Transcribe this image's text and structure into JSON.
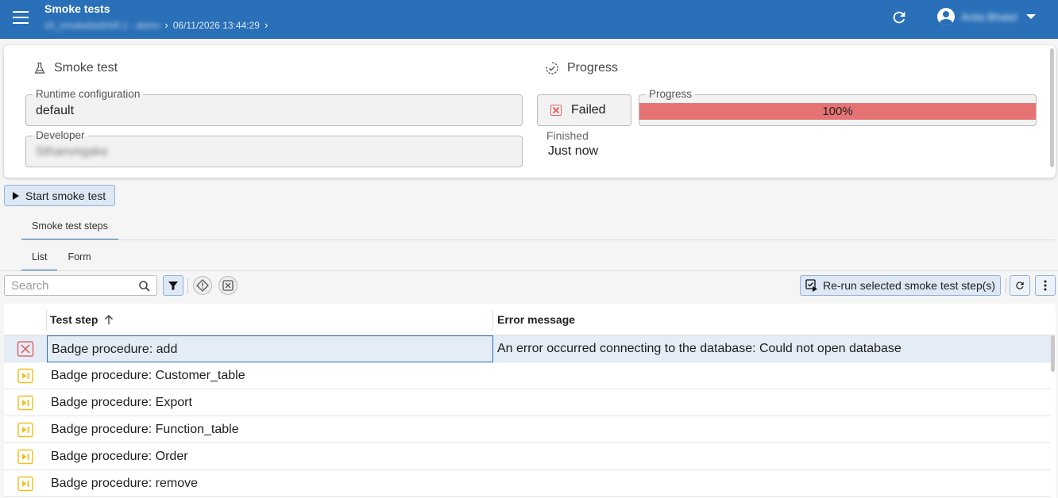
{
  "header": {
    "title": "Smoke tests",
    "breadcrumb_1": "sh_smokebedrieft 1 - demo",
    "breadcrumb_2": "06/11/2026 13:44:29",
    "user_name": "Anita Bhatel"
  },
  "smoke_test": {
    "heading": "Smoke test",
    "runtime_label": "Runtime configuration",
    "runtime_value": "default",
    "developer_label": "Developer",
    "developer_value": "Sthanvisjake"
  },
  "progress": {
    "heading": "Progress",
    "status": "Failed",
    "progress_label": "Progress",
    "progress_value": 100,
    "progress_text": "100%",
    "finished_label": "Finished",
    "finished_value": "Just now"
  },
  "actions": {
    "start_label": "Start smoke test",
    "rerun_label": "Re-run selected smoke test step(s)"
  },
  "tabs": {
    "main": [
      {
        "label": "Smoke test steps"
      }
    ],
    "view": [
      {
        "label": "List"
      },
      {
        "label": "Form"
      }
    ]
  },
  "search": {
    "placeholder": "Search"
  },
  "grid": {
    "columns": [
      {
        "label": "Test step"
      },
      {
        "label": "Error message"
      }
    ],
    "rows": [
      {
        "status": "failed",
        "step": "Badge procedure: add",
        "error": "An error occurred connecting to the database: Could not open database"
      },
      {
        "status": "skipped",
        "step": "Badge procedure: Customer_table",
        "error": ""
      },
      {
        "status": "skipped",
        "step": "Badge procedure: Export",
        "error": ""
      },
      {
        "status": "skipped",
        "step": "Badge procedure: Function_table",
        "error": ""
      },
      {
        "status": "skipped",
        "step": "Badge procedure: Order",
        "error": ""
      },
      {
        "status": "skipped",
        "step": "Badge procedure: remove",
        "error": ""
      }
    ]
  },
  "colors": {
    "appbar": "#2a70b8",
    "failed": "#e06666",
    "skipped": "#f0c020",
    "progress_fill": "#e57373"
  }
}
